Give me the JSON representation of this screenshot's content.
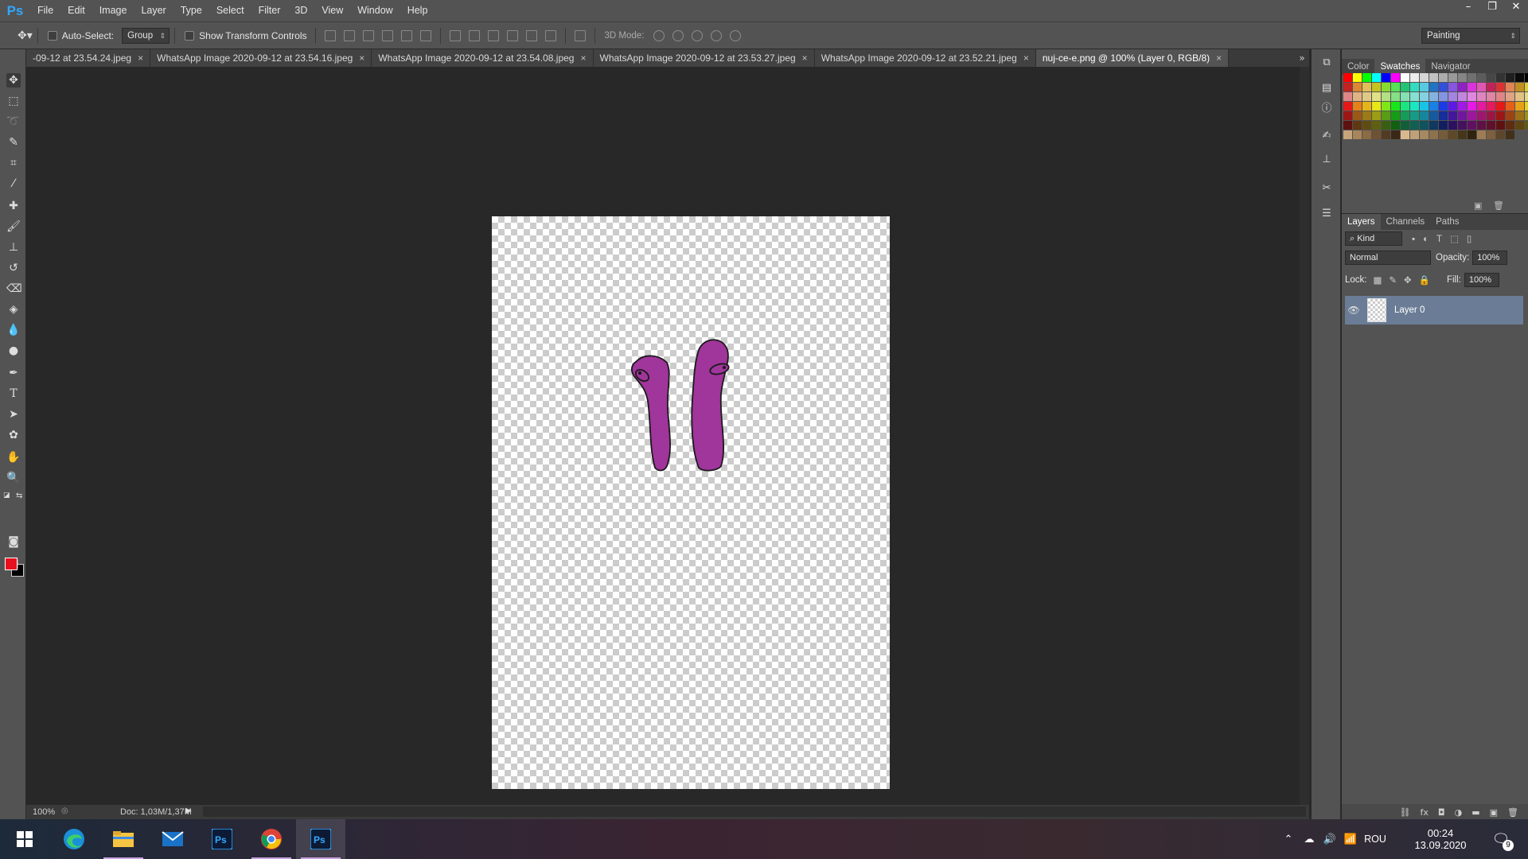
{
  "app": {
    "logo": "Ps"
  },
  "menu": [
    "File",
    "Edit",
    "Image",
    "Layer",
    "Type",
    "Select",
    "Filter",
    "3D",
    "View",
    "Window",
    "Help"
  ],
  "window_controls": [
    "–",
    "❐",
    "✕"
  ],
  "options_bar": {
    "auto_select_label": "Auto-Select:",
    "auto_select_value": "Group",
    "transform_label": "Show Transform Controls",
    "mode_3d_label": "3D Mode:",
    "workspace": "Painting"
  },
  "tabs": [
    {
      "label": "-09-12 at 23.54.24.jpeg",
      "active": false
    },
    {
      "label": "WhatsApp Image 2020-09-12 at 23.54.16.jpeg",
      "active": false
    },
    {
      "label": "WhatsApp Image 2020-09-12 at 23.54.08.jpeg",
      "active": false
    },
    {
      "label": "WhatsApp Image 2020-09-12 at 23.53.27.jpeg",
      "active": false
    },
    {
      "label": "WhatsApp Image 2020-09-12 at 23.52.21.jpeg",
      "active": false
    },
    {
      "label": "nuj-ce-e.png @ 100% (Layer 0, RGB/8)",
      "active": true
    }
  ],
  "tab_close": "×",
  "tab_overflow": "»",
  "status": {
    "zoom": "100%",
    "doc": "Doc: 1,03M/1,37M"
  },
  "colors": {
    "foreground": "#e8101e",
    "background": "#000000",
    "shape_fill": "#a0359b"
  },
  "swatches_panel": {
    "tabs": [
      "Color",
      "Swatches",
      "Navigator"
    ],
    "active": "Swatches"
  },
  "layers_panel": {
    "tabs": [
      "Layers",
      "Channels",
      "Paths"
    ],
    "active": "Layers",
    "filter": "Kind",
    "blend_mode": "Normal",
    "opacity_label": "Opacity:",
    "opacity_value": "100%",
    "lock_label": "Lock:",
    "fill_label": "Fill:",
    "fill_value": "100%",
    "layers": [
      {
        "name": "Layer 0",
        "visible": true,
        "selected": true
      }
    ]
  },
  "taskbar": {
    "language": "ROU",
    "time": "00:24",
    "date": "13.09.2020",
    "notifications": "9"
  }
}
